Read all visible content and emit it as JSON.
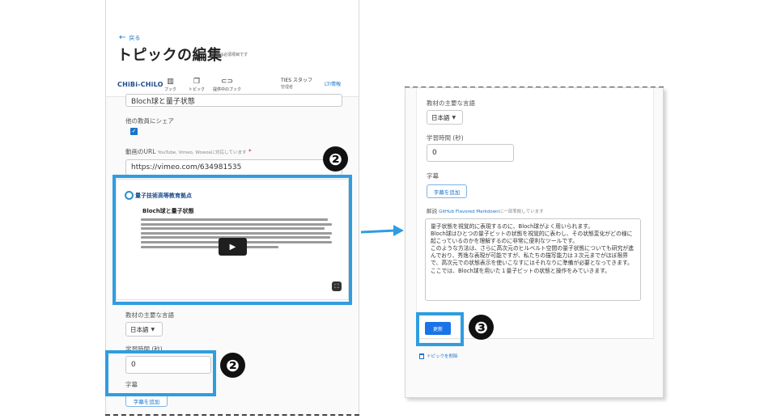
{
  "left": {
    "back_label": "戻る",
    "page_title": "トピックの編集",
    "required_note": "は必須項目です",
    "header": {
      "logo": "CHiBi-CHiLO",
      "nav": [
        {
          "label": "ブック",
          "icon": "book-icon"
        },
        {
          "label": "トピック",
          "icon": "topic-icon"
        },
        {
          "label": "提供中のブック",
          "icon": "link-icon"
        }
      ],
      "user_name": "TIES スタッフ",
      "user_role": "管理者",
      "lti_label": "LTI情報"
    },
    "topic_title_value": "Bloch球と量子状態",
    "share_label": "他の教員にシェア",
    "share_checked": true,
    "video_url_label": "動画のURL",
    "video_url_hint": "YouTube, Vimeo, Wowzaに対応しています",
    "video_url_value": "https://vimeo.com/634981535",
    "video": {
      "logo_text": "量子技術高等教育拠点",
      "title": "Bloch球と量子状態"
    },
    "language_label": "教材の主要な言語",
    "language_value": "日本語",
    "time_label": "学習時間 (秒)",
    "time_value": "0",
    "subtitles_label": "字幕",
    "add_subtitles_label": "字幕を追加"
  },
  "right": {
    "language_label": "教材の主要な言語",
    "language_value": "日本語",
    "time_label": "学習時間 (秒)",
    "time_value": "0",
    "subtitles_label": "字幕",
    "add_subtitles_label": "字幕を追加",
    "description_label": "解説",
    "description_link": "GitHub Flavored Markdown",
    "description_hint": "に一部準拠しています",
    "description_lines": [
      "量子状態を視覚的に表現するのに、Bloch球がよく用いられます。",
      "Bloch球はひとつの量子ビットの状態を視覚的に表わし、その状態変化がどの様に起こっているのかを理解するのに非常に便利なツールです。",
      "このような方法は、さらに高次元のヒルベルト空間の量子状態についても研究が進んでおり、秀逸な表現が可能ですが、私たちの描写能力は３次元までがほぼ限界で、高次元での状態表示を使いこなすにはそれなりに準備が必要となってきます。",
      "ここでは、Bloch球を用いた１量子ビットの状態と操作をみていきます。"
    ],
    "save_label": "更新",
    "delete_label": "トピックを削除"
  },
  "badges": {
    "step2": "❷",
    "step3": "❸"
  },
  "colors": {
    "highlight": "#2f9de0",
    "primary": "#1a73e8",
    "link": "#1a73c9"
  }
}
